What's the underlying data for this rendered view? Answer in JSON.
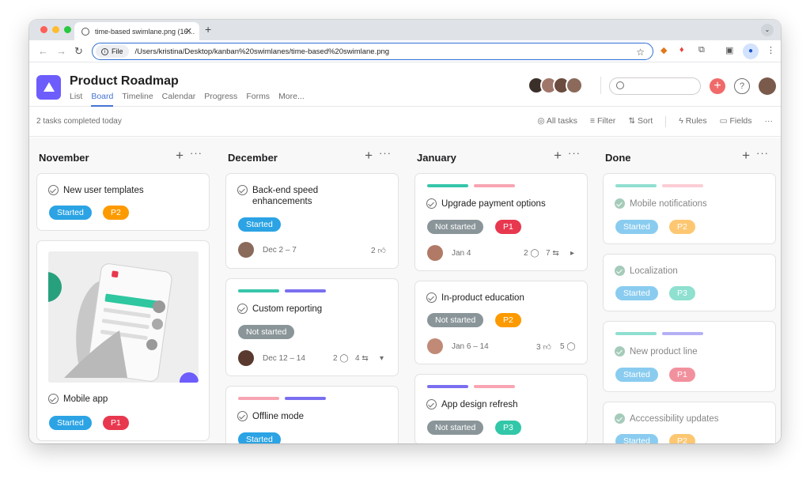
{
  "browser": {
    "tab_title": "time-based swimlane.png (16…",
    "url_chip": "File",
    "url": "/Users/kristina/Desktop/kanban%20swimlanes/time-based%20swimlane.png"
  },
  "app": {
    "title": "Product Roadmap",
    "nav": [
      "List",
      "Board",
      "Timeline",
      "Calendar",
      "Progress",
      "Forms",
      "More..."
    ],
    "active_nav": "Board"
  },
  "toolbar": {
    "completed": "2 tasks completed today",
    "all_tasks": "All tasks",
    "filter": "Filter",
    "sort": "Sort",
    "rules": "Rules",
    "fields": "Fields"
  },
  "colors": {
    "started": "#2ba3e4",
    "not_started": "#8a9599",
    "p1": "#e8384f",
    "p2": "#fd9a00",
    "p3": "#32c7a8",
    "brand": "#6d5dfc",
    "bar_teal": "#37c5ab",
    "bar_purple": "#7a6ff0",
    "bar_pink": "#f8a5b1"
  },
  "columns": [
    {
      "name": "November",
      "cards": [
        {
          "title": "New user templates",
          "status": "Started",
          "priority": "P2"
        },
        {
          "title": "Mobile app",
          "status": "Started",
          "priority": "P1",
          "image": "phone-mockup"
        }
      ]
    },
    {
      "name": "December",
      "cards": [
        {
          "title": "Back-end speed enhancements",
          "title_line2": "enhancements",
          "status": "Started",
          "date": "Dec 2 – 7",
          "likes": "2"
        },
        {
          "title": "Custom reporting",
          "status": "Not started",
          "date": "Dec 12 – 14",
          "comments": "2",
          "subtasks": "4"
        },
        {
          "title": "Offline mode",
          "status": "Started"
        }
      ]
    },
    {
      "name": "January",
      "cards": [
        {
          "title": "Upgrade payment options",
          "status": "Not started",
          "priority": "P1",
          "date": "Jan 4",
          "comments": "2",
          "subtasks": "7"
        },
        {
          "title": "In-product education",
          "status": "Not started",
          "priority": "P2",
          "date": "Jan 6 – 14",
          "likes": "3",
          "comments": "5"
        },
        {
          "title": "App design refresh",
          "status": "Not started",
          "priority": "P3"
        }
      ]
    },
    {
      "name": "Done",
      "cards": [
        {
          "title": "Mobile notifications",
          "status": "Started",
          "priority": "P2"
        },
        {
          "title": "Localization",
          "status": "Started",
          "priority": "P3"
        },
        {
          "title": "New product line",
          "status": "Started",
          "priority": "P1"
        },
        {
          "title": "Acccessibility updates",
          "status": "Started",
          "priority": "P2"
        }
      ]
    }
  ]
}
